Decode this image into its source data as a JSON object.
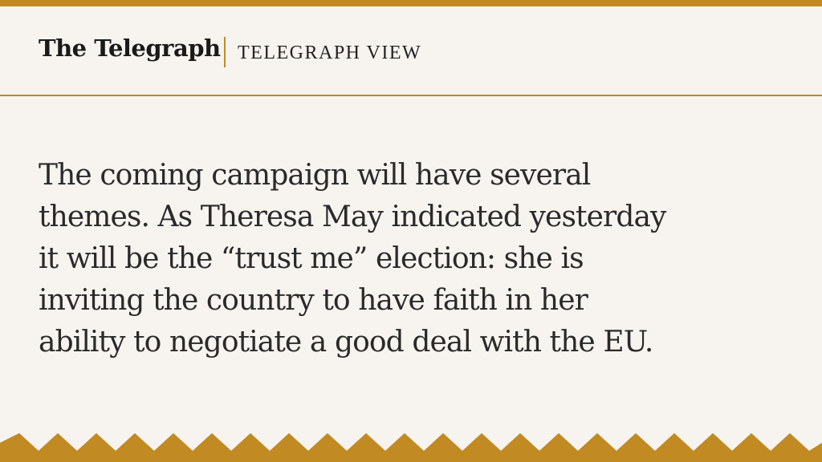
{
  "header": {
    "logo_text": "The Telegraph",
    "section_label": "TELEGRAPH VIEW"
  },
  "quote": {
    "lines": [
      "The coming campaign will have several",
      "themes. As Theresa May indicated yesterday",
      "it will be the “trust me” election: she is",
      "inviting the country to have faith in her",
      "ability to negotiate a good deal with the EU."
    ]
  },
  "colors": {
    "accent": "#c18a22",
    "background": "#f7f4f0",
    "text": "#2a2a2a"
  }
}
